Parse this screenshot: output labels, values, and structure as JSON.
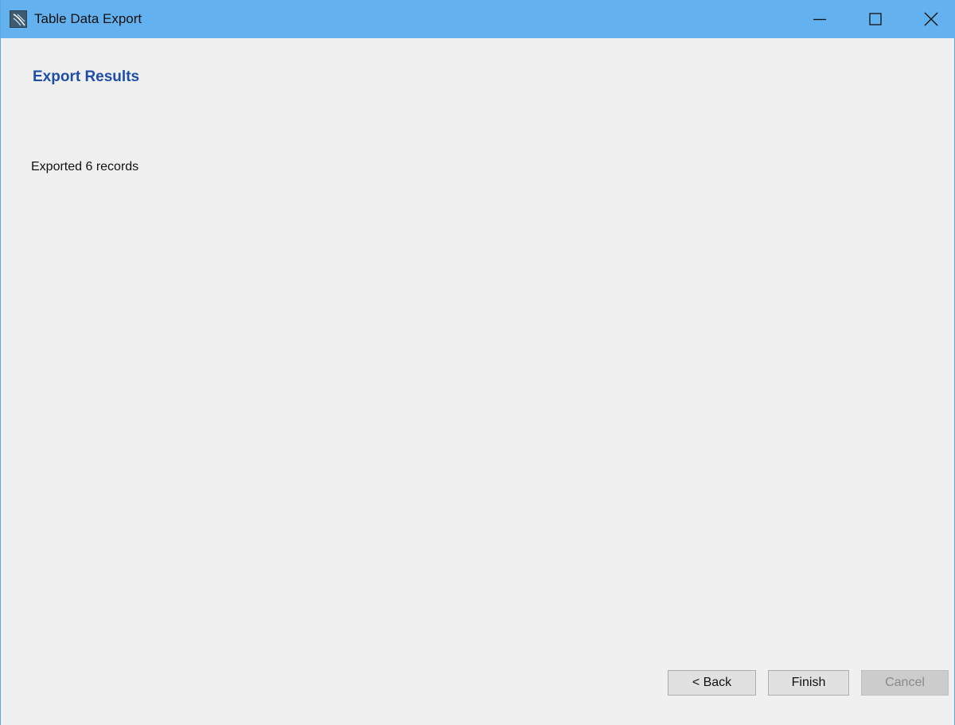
{
  "window": {
    "title": "Table Data Export",
    "icon": "mysql-workbench-icon",
    "controls": {
      "minimize_icon": "minimize-icon",
      "maximize_icon": "maximize-icon",
      "close_icon": "close-icon"
    }
  },
  "page": {
    "heading": "Export Results",
    "status": "Exported 6 records"
  },
  "buttons": {
    "back_label": "< Back",
    "finish_label": "Finish",
    "cancel_label": "Cancel",
    "cancel_enabled": false
  },
  "colors": {
    "titlebar": "#63b1ef",
    "heading": "#1f4ea8",
    "background": "#f0f0f0"
  }
}
